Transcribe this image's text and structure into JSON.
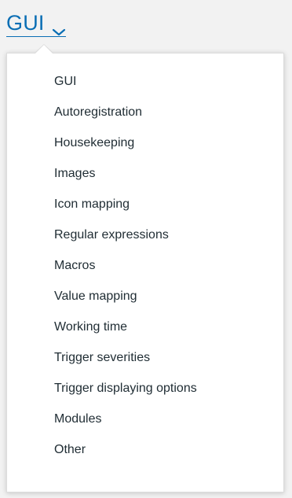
{
  "header": {
    "title": "GUI",
    "dropdown_icon": "chevron-down-icon"
  },
  "colors": {
    "link": "#0a6eb4",
    "text": "#1f2c33",
    "background": "#f2f2f2",
    "menu_background": "#ffffff"
  },
  "menu": {
    "items": [
      {
        "label": "GUI"
      },
      {
        "label": "Autoregistration"
      },
      {
        "label": "Housekeeping"
      },
      {
        "label": "Images"
      },
      {
        "label": "Icon mapping"
      },
      {
        "label": "Regular expressions"
      },
      {
        "label": "Macros"
      },
      {
        "label": "Value mapping"
      },
      {
        "label": "Working time"
      },
      {
        "label": "Trigger severities"
      },
      {
        "label": "Trigger displaying options"
      },
      {
        "label": "Modules"
      },
      {
        "label": "Other"
      }
    ]
  }
}
